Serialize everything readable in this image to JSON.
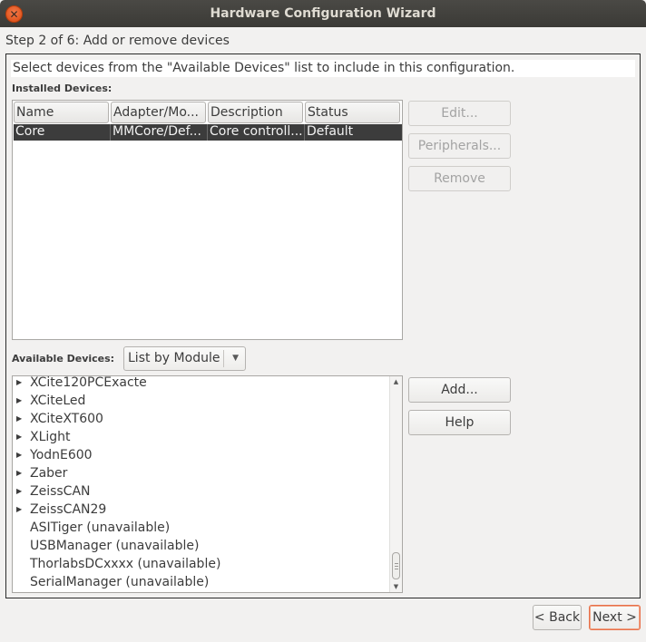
{
  "window": {
    "title": "Hardware Configuration Wizard",
    "close_glyph": "✕"
  },
  "step_label": "Step 2 of 6: Add or remove devices",
  "instructions": "Select devices from the \"Available Devices\" list to include in this configuration.",
  "installed": {
    "label": "Installed Devices:",
    "columns": [
      "Name",
      "Adapter/Mo...",
      "Description",
      "Status"
    ],
    "rows": [
      {
        "name": "Core",
        "adapter": "MMCore/Def...",
        "description": "Core controll...",
        "status": "Default",
        "selected": true
      }
    ],
    "buttons": {
      "edit": "Edit...",
      "peripherals": "Peripherals...",
      "remove": "Remove"
    }
  },
  "available": {
    "label": "Available Devices:",
    "view_mode": "List by Module",
    "items": [
      {
        "text": "XCite120PCExacte",
        "expandable": true
      },
      {
        "text": "XCiteLed",
        "expandable": true
      },
      {
        "text": "XCiteXT600",
        "expandable": true
      },
      {
        "text": "XLight",
        "expandable": true
      },
      {
        "text": "YodnE600",
        "expandable": true
      },
      {
        "text": "Zaber",
        "expandable": true
      },
      {
        "text": "ZeissCAN",
        "expandable": true
      },
      {
        "text": "ZeissCAN29",
        "expandable": true
      },
      {
        "text": "ASITiger (unavailable)",
        "expandable": false
      },
      {
        "text": "USBManager (unavailable)",
        "expandable": false
      },
      {
        "text": "ThorlabsDCxxxx (unavailable)",
        "expandable": false
      },
      {
        "text": "SerialManager (unavailable)",
        "expandable": false
      }
    ],
    "buttons": {
      "add": "Add...",
      "help": "Help"
    }
  },
  "nav": {
    "back": "< Back",
    "next": "Next >"
  },
  "icons": {
    "expand": "triangle-right-icon",
    "dropdown": "chevron-down-icon",
    "close": "close-icon"
  },
  "colors": {
    "accent": "#e95420",
    "titlebar": "#3b3a36",
    "selection": "#3c3c3c"
  }
}
